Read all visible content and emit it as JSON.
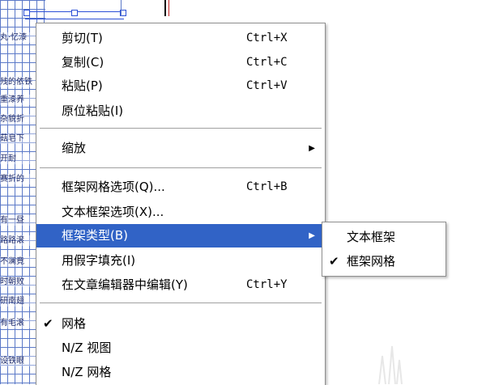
{
  "document": {
    "grid_rows": [
      "丸·忆漆",
      "",
      "",
      "",
      "",
      "残的依铁",
      "重漆养",
      "杂貌折",
      "菇皂下",
      "开耐",
      "赛折的",
      "",
      "有一昼",
      "路路滚",
      "不澜竟",
      "时朝败",
      "研南翅",
      "",
      "有毛滚",
      "",
      "设铁眼"
    ]
  },
  "context_menu": {
    "items": [
      {
        "label": "剪切(T)",
        "shortcut": "Ctrl+X"
      },
      {
        "label": "复制(C)",
        "shortcut": "Ctrl+C"
      },
      {
        "label": "粘贴(P)",
        "shortcut": "Ctrl+V"
      },
      {
        "label": "原位粘贴(I)",
        "shortcut": ""
      },
      {
        "label": "缩放",
        "shortcut": "",
        "has_submenu": true
      },
      {
        "label": "框架网格选项(Q)...",
        "shortcut": "Ctrl+B"
      },
      {
        "label": "文本框架选项(X)...",
        "shortcut": ""
      },
      {
        "label": "框架类型(B)",
        "shortcut": "",
        "has_submenu": true,
        "highlighted": true
      },
      {
        "label": "用假字填充(I)",
        "shortcut": ""
      },
      {
        "label": "在文章编辑器中编辑(Y)",
        "shortcut": "Ctrl+Y"
      },
      {
        "label": "网格",
        "shortcut": "",
        "checked": true
      },
      {
        "label": "N/Z 视图",
        "shortcut": ""
      },
      {
        "label": "N/Z 网格",
        "shortcut": ""
      }
    ]
  },
  "frame_type_submenu": {
    "items": [
      {
        "label": "文本框架",
        "checked": false
      },
      {
        "label": "框架网格",
        "checked": true
      }
    ]
  },
  "glyphs": {
    "submenu_arrow": "▶",
    "check": "✔"
  },
  "colors": {
    "highlight": "#3163c6",
    "grid_line": "#5b79c8"
  }
}
